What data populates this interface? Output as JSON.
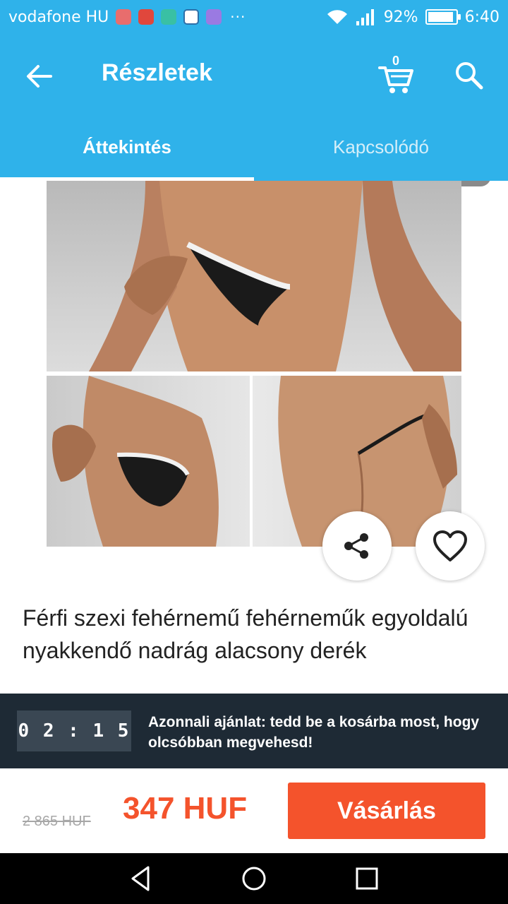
{
  "status_bar": {
    "carrier": "vodafone HU",
    "more": "···",
    "battery": "92%",
    "battery_level": 0.92,
    "time": "6:40"
  },
  "app_bar": {
    "title": "Részletek",
    "cart_count": "0",
    "icons": [
      "back-arrow-icon",
      "cart-icon",
      "search-icon"
    ]
  },
  "tabs": [
    {
      "label": "Áttekintés",
      "active": true
    },
    {
      "label": "Kapcsolódó",
      "active": false
    }
  ],
  "product": {
    "title": "Férfi szexi fehérnemű fehérneműk egyoldalú nyakkendő nadrág alacsony derék"
  },
  "offer": {
    "countdown": "0 2 : 1 5",
    "text": "Azonnali ajánlat: tedd be a kosárba most, hogy olcsóbban megvehesd!"
  },
  "purchase": {
    "old_price": "2 865 HUF",
    "new_price": "347 HUF",
    "buy_label": "Vásárlás"
  },
  "colors": {
    "brand": "#2fb2ea",
    "accent": "#f4532c",
    "banner": "#1e2a35"
  }
}
